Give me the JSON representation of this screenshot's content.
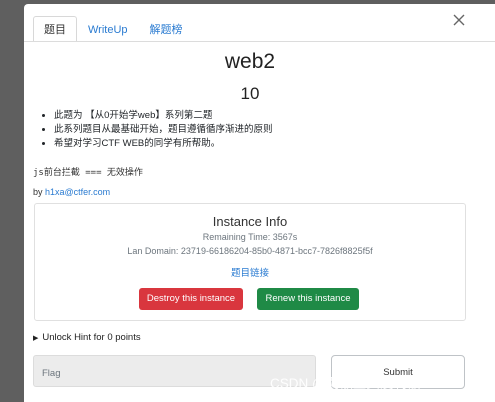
{
  "tabs": [
    "题目",
    "WriteUp",
    "解题榜"
  ],
  "challenge": {
    "title": "web2",
    "points": "10",
    "description": [
      "此题为 【从0开始学web】系列第二题",
      "此系列题目从最基础开始，题目遵循循序渐进的原则",
      "希望对学习CTF WEB的同学有所帮助。"
    ],
    "hint_line": "js前台拦截 === 无效操作",
    "by_prefix": "by ",
    "author": "h1xa@ctfer.com"
  },
  "instance": {
    "title": "Instance Info",
    "remaining": "Remaining Time: 3567s",
    "lan_domain": "Lan Domain: 23719-66186204-85b0-4871-bcc7-7826f8825f5f",
    "link_label": "题目链接",
    "destroy_label": "Destroy this instance",
    "renew_label": "Renew this instance"
  },
  "unlock_hint": "Unlock Hint for 0 points",
  "flag": {
    "placeholder": "Flag"
  },
  "submit_label": "Submit",
  "watermark": "CSDN @剁椒鱼头没剁椒",
  "colors": {
    "link": "#2a7bd1",
    "destroy": "#d9363e",
    "renew": "#1f8a46",
    "overlay": "#5f5f5f"
  }
}
